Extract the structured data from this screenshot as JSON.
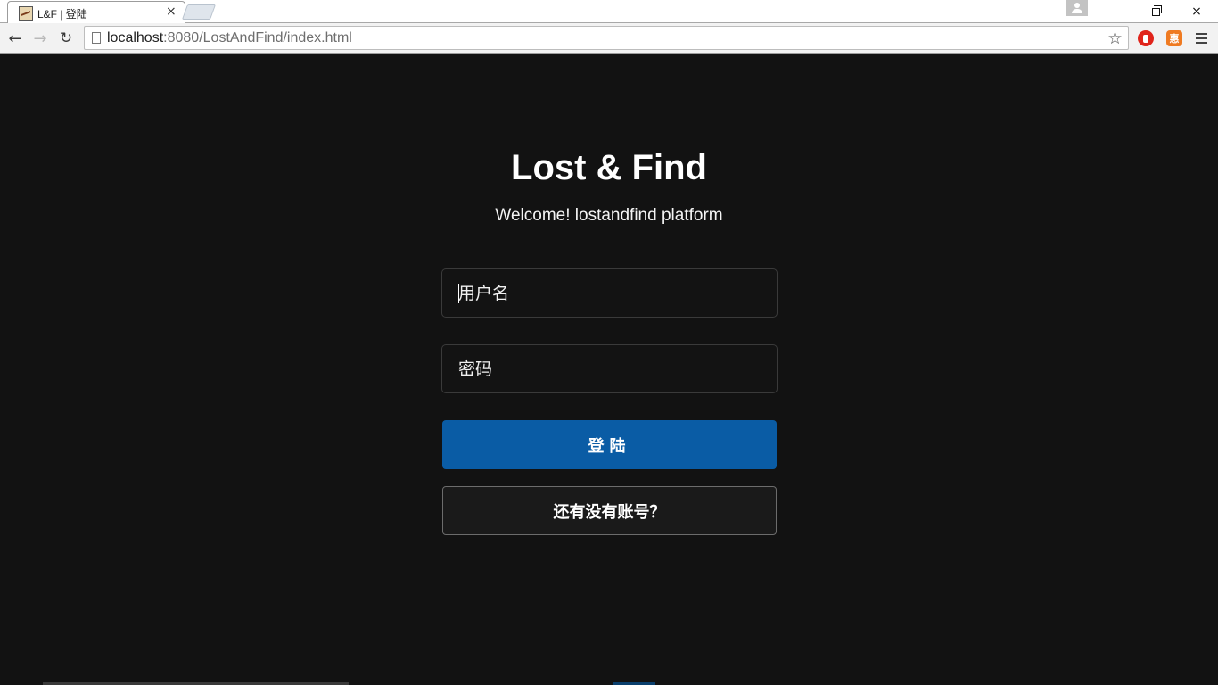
{
  "browser": {
    "tab_title": "L&F | 登陆",
    "tab_close": "×",
    "url_host": "localhost",
    "url_rest": ":8080/LostAndFind/index.html",
    "star": "☆",
    "ext_orange_label": "惠",
    "back": "←",
    "forward": "→",
    "reload": "↻"
  },
  "page": {
    "title": "Lost & Find",
    "subtitle": "Welcome! lostandfind platform",
    "username_placeholder": "用户名",
    "password_placeholder": "密码",
    "login_label": "登陆",
    "register_label": "还有没有账号？"
  },
  "colors": {
    "background": "#121212",
    "primary_button": "#0a5ca5",
    "text": "#ffffff"
  }
}
